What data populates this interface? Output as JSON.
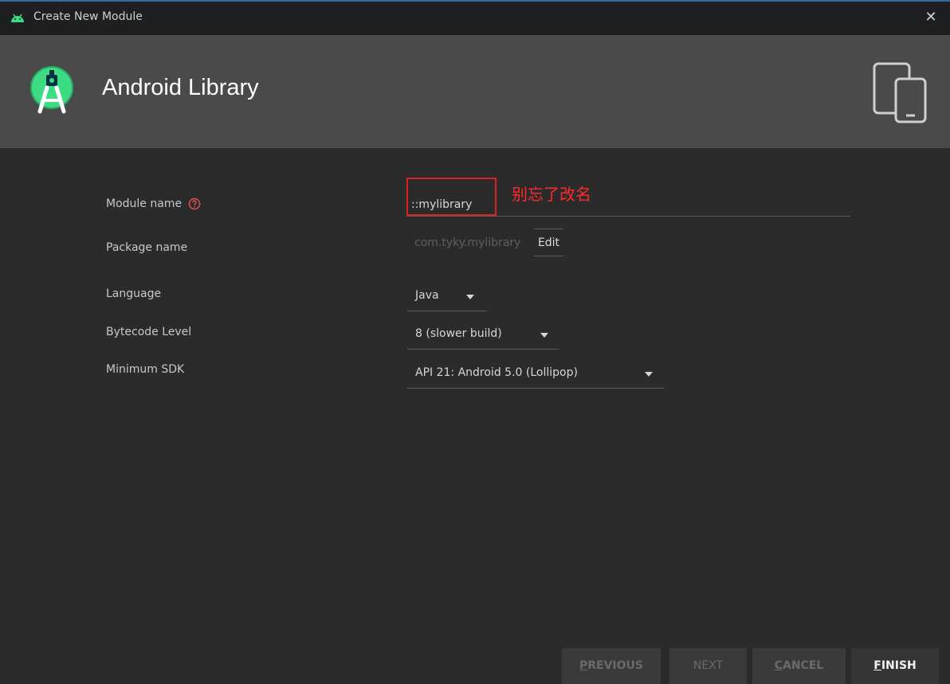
{
  "window": {
    "title": "Create New Module",
    "close_glyph": "✕"
  },
  "header": {
    "heading": "Android Library",
    "logo_icon": "android-studio-icon",
    "device_icon": "devices-icon"
  },
  "form": {
    "module_name": {
      "label": "Module name",
      "value": "::mylibrary",
      "help_icon": "help-icon"
    },
    "annotation": "别忘了改名",
    "package_name": {
      "label": "Package name",
      "value": "com.tyky.mylibrary",
      "edit_label": "Edit"
    },
    "language": {
      "label": "Language",
      "value": "Java"
    },
    "bytecode": {
      "label": "Bytecode Level",
      "value": "8 (slower build)"
    },
    "min_sdk": {
      "label": "Minimum SDK",
      "value": "API 21: Android 5.0 (Lollipop)"
    }
  },
  "buttons": {
    "previous": {
      "mnemonic": "P",
      "rest": "REVIOUS"
    },
    "next": "NEXT",
    "cancel": {
      "mnemonic": "C",
      "rest": "ANCEL"
    },
    "finish": {
      "mnemonic": "F",
      "rest": "INISH"
    }
  },
  "colors": {
    "header_bg": "#4a4a4a",
    "body_bg": "#2b2b2b",
    "annotation": "#ff2a2a",
    "android_green": "#3ddc84"
  }
}
